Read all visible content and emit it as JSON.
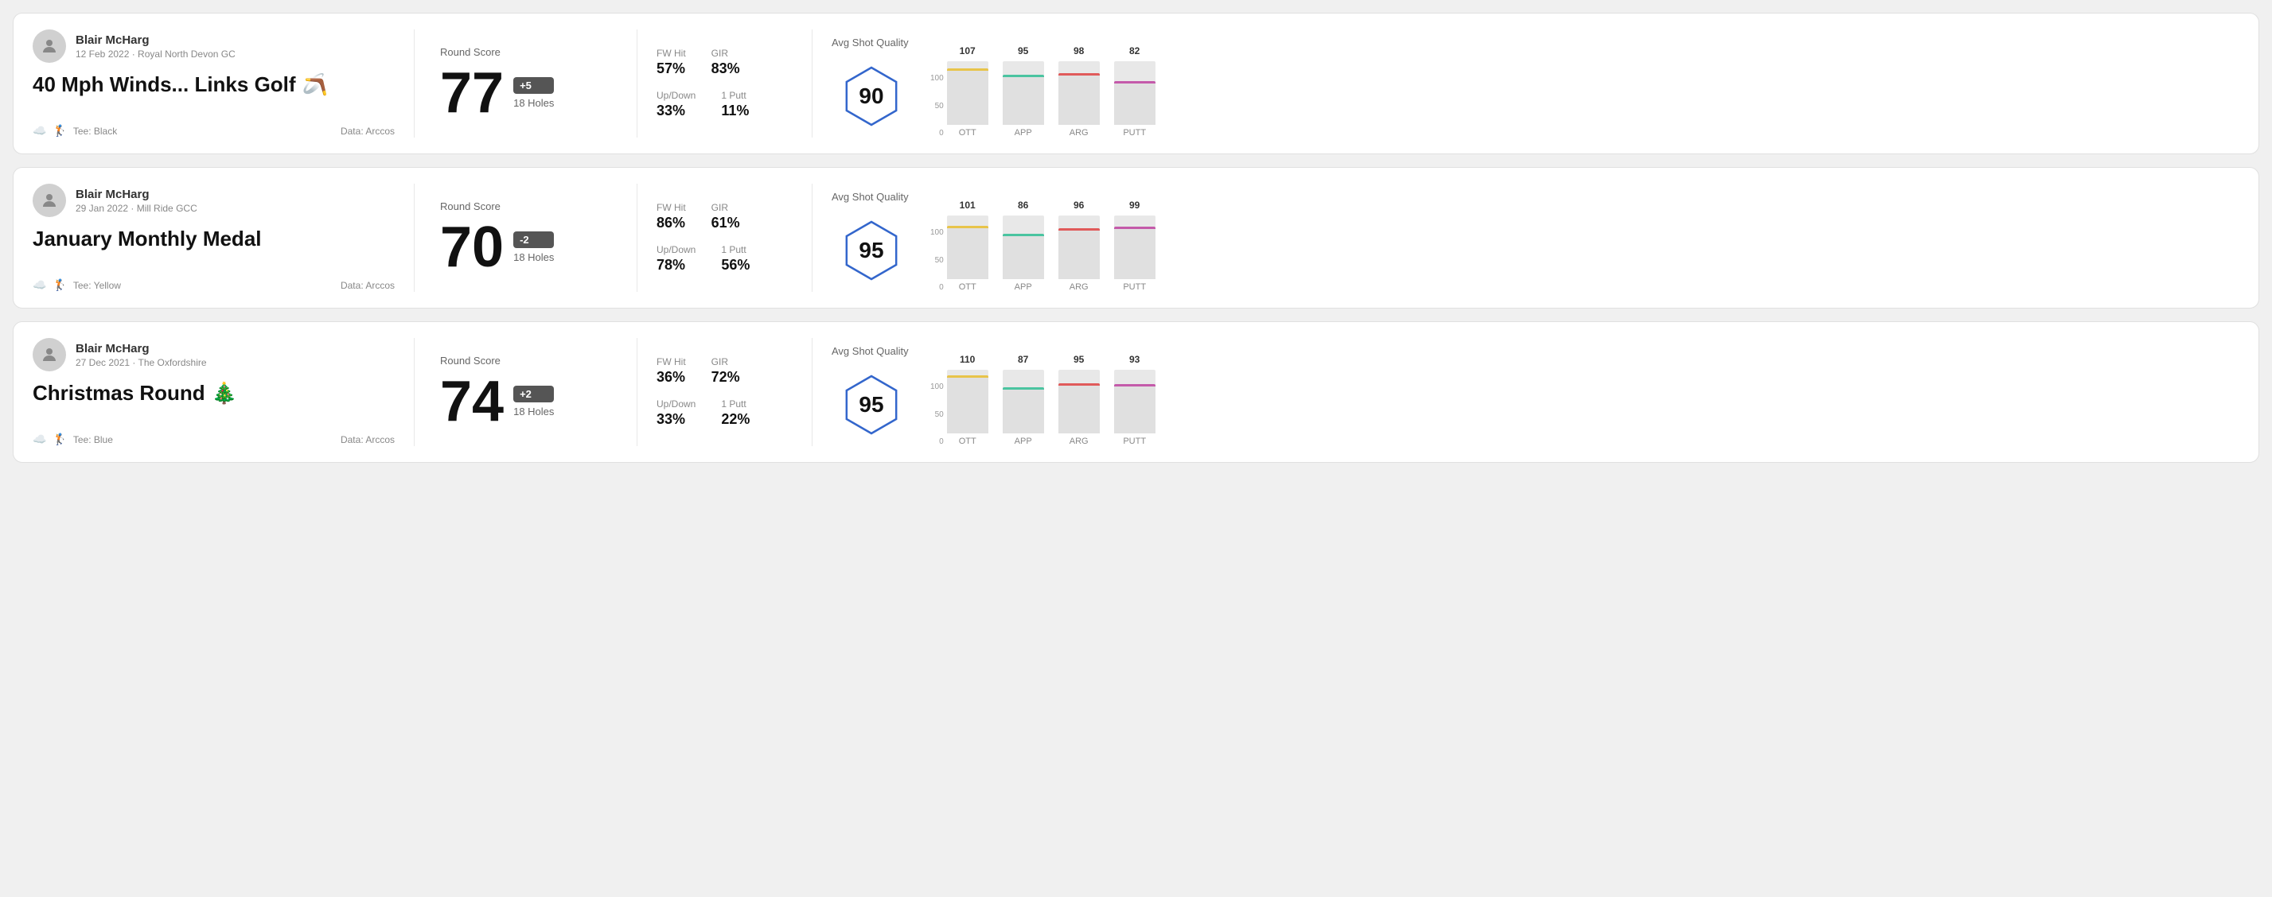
{
  "rounds": [
    {
      "id": "round1",
      "user": {
        "name": "Blair McHarg",
        "date": "12 Feb 2022",
        "venue": "Royal North Devon GC"
      },
      "title": "40 Mph Winds... Links Golf",
      "title_emoji": "🪃",
      "tee": "Black",
      "data_source": "Data: Arccos",
      "score": 77,
      "score_diff": "+5",
      "score_diff_sign": "positive",
      "holes": "18 Holes",
      "fw_hit": "57%",
      "gir": "83%",
      "up_down": "33%",
      "one_putt": "11%",
      "avg_shot_quality": 90,
      "chart": {
        "bars": [
          {
            "label": "OTT",
            "value": 107,
            "color": "#e8c44a"
          },
          {
            "label": "APP",
            "value": 95,
            "color": "#4ac4a0"
          },
          {
            "label": "ARG",
            "value": 98,
            "color": "#e05a5a"
          },
          {
            "label": "PUTT",
            "value": 82,
            "color": "#c45aaa"
          }
        ]
      }
    },
    {
      "id": "round2",
      "user": {
        "name": "Blair McHarg",
        "date": "29 Jan 2022",
        "venue": "Mill Ride GCC"
      },
      "title": "January Monthly Medal",
      "title_emoji": "",
      "tee": "Yellow",
      "data_source": "Data: Arccos",
      "score": 70,
      "score_diff": "-2",
      "score_diff_sign": "negative",
      "holes": "18 Holes",
      "fw_hit": "86%",
      "gir": "61%",
      "up_down": "78%",
      "one_putt": "56%",
      "avg_shot_quality": 95,
      "chart": {
        "bars": [
          {
            "label": "OTT",
            "value": 101,
            "color": "#e8c44a"
          },
          {
            "label": "APP",
            "value": 86,
            "color": "#4ac4a0"
          },
          {
            "label": "ARG",
            "value": 96,
            "color": "#e05a5a"
          },
          {
            "label": "PUTT",
            "value": 99,
            "color": "#c45aaa"
          }
        ]
      }
    },
    {
      "id": "round3",
      "user": {
        "name": "Blair McHarg",
        "date": "27 Dec 2021",
        "venue": "The Oxfordshire"
      },
      "title": "Christmas Round",
      "title_emoji": "🎄",
      "tee": "Blue",
      "data_source": "Data: Arccos",
      "score": 74,
      "score_diff": "+2",
      "score_diff_sign": "positive",
      "holes": "18 Holes",
      "fw_hit": "36%",
      "gir": "72%",
      "up_down": "33%",
      "one_putt": "22%",
      "avg_shot_quality": 95,
      "chart": {
        "bars": [
          {
            "label": "OTT",
            "value": 110,
            "color": "#e8c44a"
          },
          {
            "label": "APP",
            "value": 87,
            "color": "#4ac4a0"
          },
          {
            "label": "ARG",
            "value": 95,
            "color": "#e05a5a"
          },
          {
            "label": "PUTT",
            "value": 93,
            "color": "#c45aaa"
          }
        ]
      }
    }
  ],
  "labels": {
    "round_score": "Round Score",
    "avg_shot_quality": "Avg Shot Quality",
    "fw_hit": "FW Hit",
    "gir": "GIR",
    "up_down": "Up/Down",
    "one_putt": "1 Putt",
    "y_axis": [
      "100",
      "50",
      "0"
    ]
  }
}
